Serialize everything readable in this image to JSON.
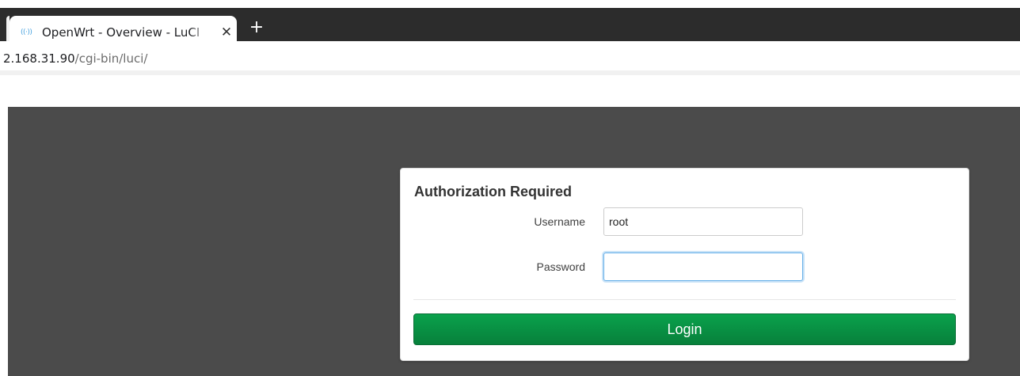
{
  "browser": {
    "tab": {
      "title": "OpenWrt - Overview - LuCI",
      "favicon": "wireless-signal-icon",
      "close_glyph": "✕"
    },
    "new_tab_glyph": "+",
    "address": {
      "host": "2.168.31.90",
      "path": "/cgi-bin/luci/"
    }
  },
  "login": {
    "title": "Authorization Required",
    "username_label": "Username",
    "username_value": "root",
    "password_label": "Password",
    "password_value": "",
    "button_label": "Login"
  },
  "colors": {
    "tab_strip": "#2c2c2c",
    "page_background": "#4b4b4b",
    "login_button": "#07913f",
    "focus_ring": "#66afe9"
  }
}
